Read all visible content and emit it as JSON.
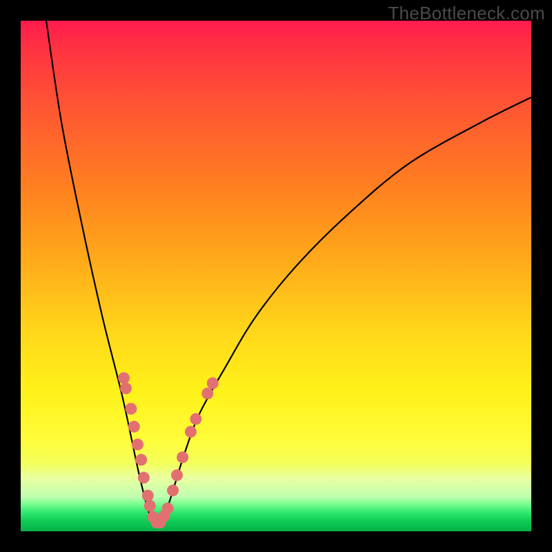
{
  "watermark": "TheBottleneck.com",
  "colors": {
    "curve_stroke": "#000000",
    "dot_fill": "#e27070",
    "frame_bg": "#000000"
  },
  "chart_data": {
    "type": "line",
    "title": "",
    "xlabel": "",
    "ylabel": "",
    "xlim": [
      0,
      100
    ],
    "ylim": [
      0,
      100
    ],
    "note": "Bottleneck-style V curve on red→yellow→green gradient. No numeric axes shown; values estimated from pixel positions on 0–100 normalized axes (y=0 top, y=100 bottom/green).",
    "series": [
      {
        "name": "bottleneck-curve",
        "x": [
          5,
          8,
          12,
          16,
          20,
          23,
          25,
          26.5,
          28.5,
          32,
          35,
          40,
          46,
          54,
          64,
          76,
          90,
          100
        ],
        "y": [
          0,
          20,
          40,
          58,
          74,
          88,
          96,
          99,
          96,
          85,
          77,
          68,
          58,
          48,
          38,
          28,
          20,
          15
        ]
      }
    ],
    "markers": [
      {
        "name": "left-cluster",
        "points": [
          {
            "x": 20.2,
            "y": 70
          },
          {
            "x": 20.6,
            "y": 72
          },
          {
            "x": 21.6,
            "y": 76
          },
          {
            "x": 22.2,
            "y": 79.5
          },
          {
            "x": 22.9,
            "y": 83
          },
          {
            "x": 23.6,
            "y": 86
          },
          {
            "x": 24.1,
            "y": 89.5
          },
          {
            "x": 24.9,
            "y": 93
          },
          {
            "x": 25.3,
            "y": 95
          },
          {
            "x": 25.9,
            "y": 97.2
          },
          {
            "x": 26.6,
            "y": 98.3
          },
          {
            "x": 27.3,
            "y": 98.3
          }
        ]
      },
      {
        "name": "right-cluster",
        "points": [
          {
            "x": 28.1,
            "y": 97
          },
          {
            "x": 28.8,
            "y": 95.5
          },
          {
            "x": 29.8,
            "y": 92
          },
          {
            "x": 30.6,
            "y": 89
          },
          {
            "x": 31.7,
            "y": 85.5
          },
          {
            "x": 33.3,
            "y": 80.5
          },
          {
            "x": 34.3,
            "y": 78
          },
          {
            "x": 36.6,
            "y": 73
          },
          {
            "x": 37.6,
            "y": 71
          }
        ]
      }
    ]
  }
}
